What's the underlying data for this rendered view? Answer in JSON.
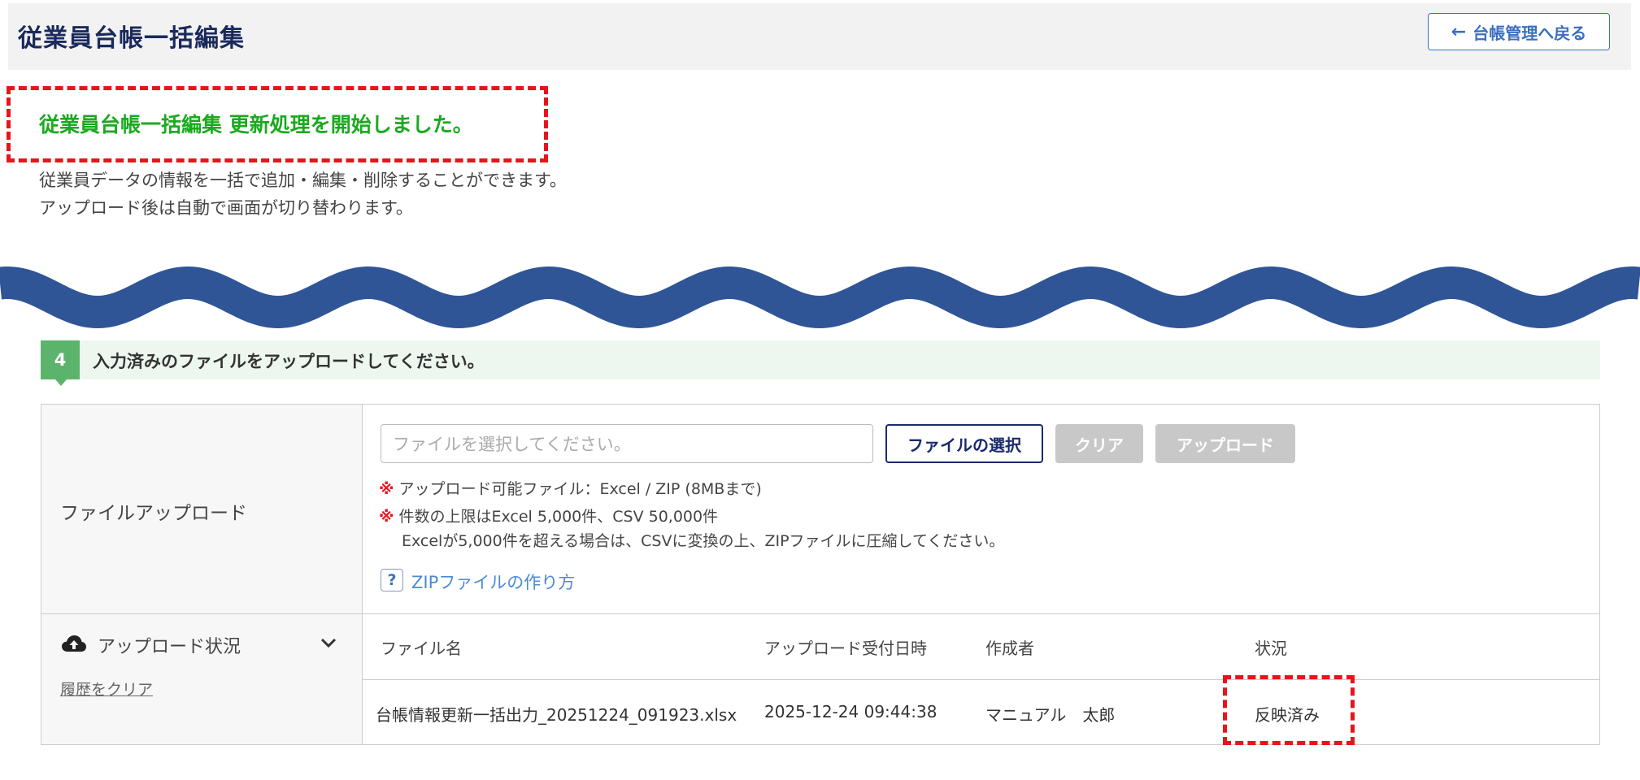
{
  "header": {
    "title": "従業員台帳一括編集",
    "back_button": "台帳管理へ戻る"
  },
  "notice": "従業員台帳一括編集 更新処理を開始しました。",
  "description": [
    "従業員データの情報を一括で追加・編集・削除することができます。",
    "アップロード後は自動で画面が切り替わります。"
  ],
  "step": {
    "number": "4",
    "text": "入力済みのファイルをアップロードしてください。"
  },
  "upload": {
    "label": "ファイルアップロード",
    "placeholder": "ファイルを選択してください。",
    "select_button": "ファイルの選択",
    "clear_button": "クリア",
    "upload_button": "アップロード",
    "note_mark": "※",
    "notes": [
      "アップロード可能ファイル：Excel / ZIP (8MBまで)",
      "件数の上限はExcel 5,000件、CSV 50,000件",
      "Excelが5,000件を超える場合は、CSVに変換の上、ZIPファイルに圧縮してください。"
    ],
    "help_icon": "?",
    "help_link": "ZIPファイルの作り方"
  },
  "status_section": {
    "title": "アップロード状況",
    "clear_history": "履歴をクリア",
    "columns": [
      "ファイル名",
      "アップロード受付日時",
      "作成者",
      "状況"
    ],
    "rows": [
      {
        "file_name": "台帳情報更新一括出力_20251224_091923.xlsx",
        "received_at": "2025-12-24 09:44:38",
        "creator": "マニュアル　太郎",
        "status": "反映済み"
      }
    ]
  },
  "colors": {
    "accent_navy": "#1a2a5c",
    "link_blue": "#3b6fc0",
    "success_green": "#1aaa1e",
    "highlight_red": "#e8141c",
    "step_green": "#5cb36c",
    "wave_blue": "#2f5597"
  },
  "icons": [
    "arrow-left-icon",
    "help-icon",
    "cloud-upload-icon",
    "chevron-down-icon"
  ]
}
